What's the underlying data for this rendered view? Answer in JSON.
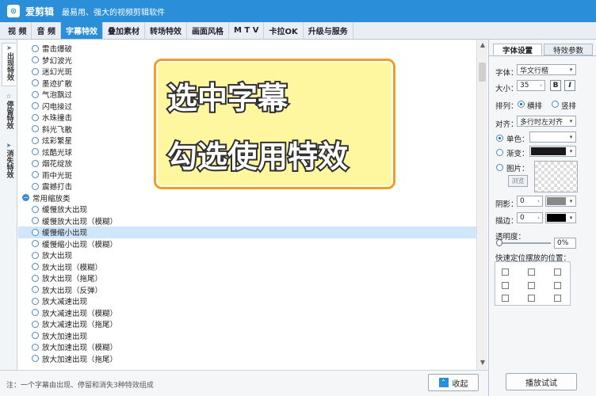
{
  "titlebar": {
    "logo_glyph": "⊙",
    "app_name": "爱剪辑",
    "subtitle": "最易用、强大的视频剪辑软件"
  },
  "menu": [
    "视 频",
    "音 频",
    "字幕特效",
    "叠加素材",
    "转场特效",
    "画面风格",
    "M T V",
    "卡拉OK",
    "升级与服务"
  ],
  "menu_active_index": 2,
  "sidebar_tabs": [
    {
      "label": "出现特效",
      "icon": "arrow-icon"
    },
    {
      "label": "停留特效",
      "icon": "star-icon"
    },
    {
      "label": "消失特效",
      "icon": "arrow-icon"
    }
  ],
  "list_rows": [
    {
      "type": "item",
      "label": "雷击爆破"
    },
    {
      "type": "item",
      "label": "梦幻波光"
    },
    {
      "type": "item",
      "label": "迷幻光斑"
    },
    {
      "type": "item",
      "label": "墨迹扩散"
    },
    {
      "type": "item",
      "label": "气泡飘过"
    },
    {
      "type": "item",
      "label": "闪电接过"
    },
    {
      "type": "item",
      "label": "水珠撞击"
    },
    {
      "type": "item",
      "label": "斜光飞散"
    },
    {
      "type": "item",
      "label": "炫彩繁星"
    },
    {
      "type": "item",
      "label": "炫酷光球"
    },
    {
      "type": "item",
      "label": "烟花绽放"
    },
    {
      "type": "item",
      "label": "雨中光斑"
    },
    {
      "type": "item",
      "label": "震撼打击"
    },
    {
      "type": "category",
      "label": "常用缩放类",
      "icon_glyph": "−"
    },
    {
      "type": "item",
      "label": "缓慢放大出现"
    },
    {
      "type": "item",
      "label": "缓慢放大出现（模糊）"
    },
    {
      "type": "item",
      "label": "缓慢缩小出现",
      "selected": true
    },
    {
      "type": "item",
      "label": "缓慢缩小出现（模糊）"
    },
    {
      "type": "item",
      "label": "放大出现"
    },
    {
      "type": "item",
      "label": "放大出现（模糊）"
    },
    {
      "type": "item",
      "label": "放大出现（拖尾）"
    },
    {
      "type": "item",
      "label": "放大出现（反弹）"
    },
    {
      "type": "item",
      "label": "放大减速出现"
    },
    {
      "type": "item",
      "label": "放大减速出现（模糊）"
    },
    {
      "type": "item",
      "label": "放大减速出现（拖尾）"
    },
    {
      "type": "item",
      "label": "放大加速出现"
    },
    {
      "type": "item",
      "label": "放大加速出现（模糊）"
    },
    {
      "type": "item",
      "label": "放大加速出现（拖尾）"
    }
  ],
  "scrollbar": {
    "up_glyph": "▲",
    "down_glyph": "▼"
  },
  "callout": {
    "line1": "选中字幕",
    "line2": "勾选使用特效"
  },
  "footer": {
    "note": "注：一个字幕由出现、停留和消失3种特效组成",
    "collapse_label": "收起",
    "collapse_glyph": "⌃"
  },
  "right_panel": {
    "tabs": [
      "字体设置",
      "特效参数"
    ],
    "active_tab": 0,
    "font_label": "字体：",
    "font_value": "华文行楷",
    "size_label": "大小：",
    "size_value": "35",
    "bold_glyph": "B",
    "italic_glyph": "I",
    "arrange_label": "排列：",
    "arrange_options": [
      "横排",
      "竖排"
    ],
    "align_label": "对齐：",
    "align_value": "多行时左对齐",
    "color_single_label": "单色：",
    "color_gradient_label": "渐变：",
    "image_label": "图片：",
    "browse_label": "浏览",
    "shadow_label": "阴影：",
    "shadow_value": "0",
    "stroke_label": "描边：",
    "stroke_value": "0",
    "opacity_label": "透明度：",
    "opacity_value": "0%",
    "position_label": "快速定位摆放的位置：",
    "play_label": "播放试试"
  },
  "glyphs": {
    "dropdown": "▾",
    "spin": "›"
  },
  "colors": {
    "accent": "#2a8fd8",
    "selection": "#cfe6fb",
    "callout_bg": "#fff6a0",
    "callout_border": "#f0a020",
    "gradient_swatch": "#1a1a1a",
    "shadow_swatch": "#888888",
    "stroke_swatch": "#000000"
  }
}
